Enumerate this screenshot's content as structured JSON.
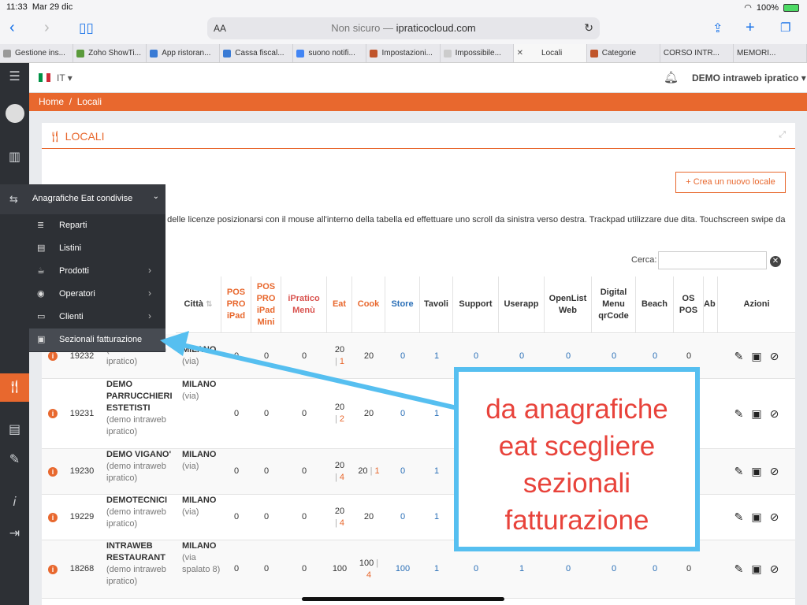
{
  "status": {
    "time": "11:33",
    "date": "Mar 29 dic",
    "battery": "100%"
  },
  "safari": {
    "aa": "AA",
    "url_prefix": "Non sicuro — ",
    "url_host": "ipraticocloud.com"
  },
  "tabs": [
    {
      "label": "Gestione ins..."
    },
    {
      "label": "Zoho ShowTi..."
    },
    {
      "label": "App ristoran..."
    },
    {
      "label": "Cassa fiscal..."
    },
    {
      "label": "suono notifi..."
    },
    {
      "label": "Impostazioni..."
    },
    {
      "label": "Impossibile..."
    },
    {
      "label": "Locali"
    },
    {
      "label": "Categorie"
    },
    {
      "label": "CORSO INTR..."
    },
    {
      "label": "MEMORI..."
    }
  ],
  "topbar": {
    "lang": "IT",
    "user": "DEMO intraweb ipratico"
  },
  "breadcrumb": {
    "home": "Home",
    "sep": "/",
    "current": "Locali"
  },
  "card": {
    "title": "LOCALI",
    "new_button": "Crea un nuovo locale",
    "info": "e delle licenze posizionarsi con il mouse all'interno della tabella ed effettuare uno scroll da sinistra verso destra. Trackpad utilizzare due dita. Touchscreen swipe da",
    "search_label": "Cerca:"
  },
  "columns": [
    "Città",
    "POS PRO iPad",
    "POS PRO iPad Mini",
    "iPratico Menù",
    "Eat",
    "Cook",
    "Store",
    "Tavoli",
    "Support",
    "Userapp",
    "OpenList Web",
    "Digital Menu qrCode",
    "Beach",
    "OS POS",
    "Ab",
    "Azioni"
  ],
  "rows": [
    {
      "id": "19232",
      "name": "",
      "owner": "(demo intraweb ipratico)",
      "city": "MILANO",
      "addr": "(via)",
      "pos": "0",
      "mini": "0",
      "menu": "0",
      "eat_a": "20",
      "eat_b": "1",
      "cook_a": "20",
      "cook_b": "",
      "store": "0",
      "tavoli": "1",
      "support": "0",
      "userapp": "0",
      "openlist": "0",
      "digital": "0",
      "beach": "0",
      "ospos": "0"
    },
    {
      "id": "19231",
      "name": "DEMO PARRUCCHIERI ESTETISTI",
      "owner": "(demo intraweb ipratico)",
      "city": "MILANO",
      "addr": "(via)",
      "pos": "0",
      "mini": "0",
      "menu": "0",
      "eat_a": "20",
      "eat_b": "2",
      "cook_a": "20",
      "cook_b": "",
      "store": "0",
      "tavoli": "1"
    },
    {
      "id": "19230",
      "name": "DEMO VIGANO'",
      "owner": "(demo intraweb ipratico)",
      "city": "MILANO",
      "addr": "(via)",
      "pos": "0",
      "mini": "0",
      "menu": "0",
      "eat_a": "20",
      "eat_b": "4",
      "cook_a": "20",
      "cook_b": "1",
      "store": "0",
      "tavoli": "1"
    },
    {
      "id": "19229",
      "name": "DEMOTECNICI",
      "owner": "(demo intraweb ipratico)",
      "city": "MILANO",
      "addr": "(via)",
      "pos": "0",
      "mini": "0",
      "menu": "0",
      "eat_a": "20",
      "eat_b": "4",
      "cook_a": "20",
      "cook_b": "",
      "store": "0",
      "tavoli": "1"
    },
    {
      "id": "18268",
      "name": "INTRAWEB RESTAURANT",
      "owner": "(demo intraweb ipratico)",
      "city": "MILANO",
      "addr": "(via spalato 8)",
      "pos": "0",
      "mini": "0",
      "menu": "0",
      "eat_a": "100",
      "eat_b": "",
      "cook_a": "100",
      "cook_b": "4",
      "store": "100",
      "tavoli": "1",
      "support": "0",
      "userapp": "1",
      "openlist": "0",
      "digital": "0",
      "beach": "0",
      "ospos": "0"
    }
  ],
  "menu": {
    "header": "Anagrafiche Eat condivise",
    "items": [
      {
        "label": "Reparti",
        "arrow": ""
      },
      {
        "label": "Listini",
        "arrow": ""
      },
      {
        "label": "Prodotti",
        "arrow": "›"
      },
      {
        "label": "Operatori",
        "arrow": "›"
      },
      {
        "label": "Clienti",
        "arrow": "›"
      },
      {
        "label": "Sezionali fatturazione",
        "arrow": ""
      }
    ]
  },
  "callout": {
    "line1": "da anagrafiche",
    "line2": "eat scegliere",
    "line3": "sezionali",
    "line4": "fatturazione"
  },
  "colors": {
    "accent": "#e8682e",
    "sidebar": "#2d3035",
    "callout_border": "#56bff0",
    "callout_text": "#e8433b"
  }
}
